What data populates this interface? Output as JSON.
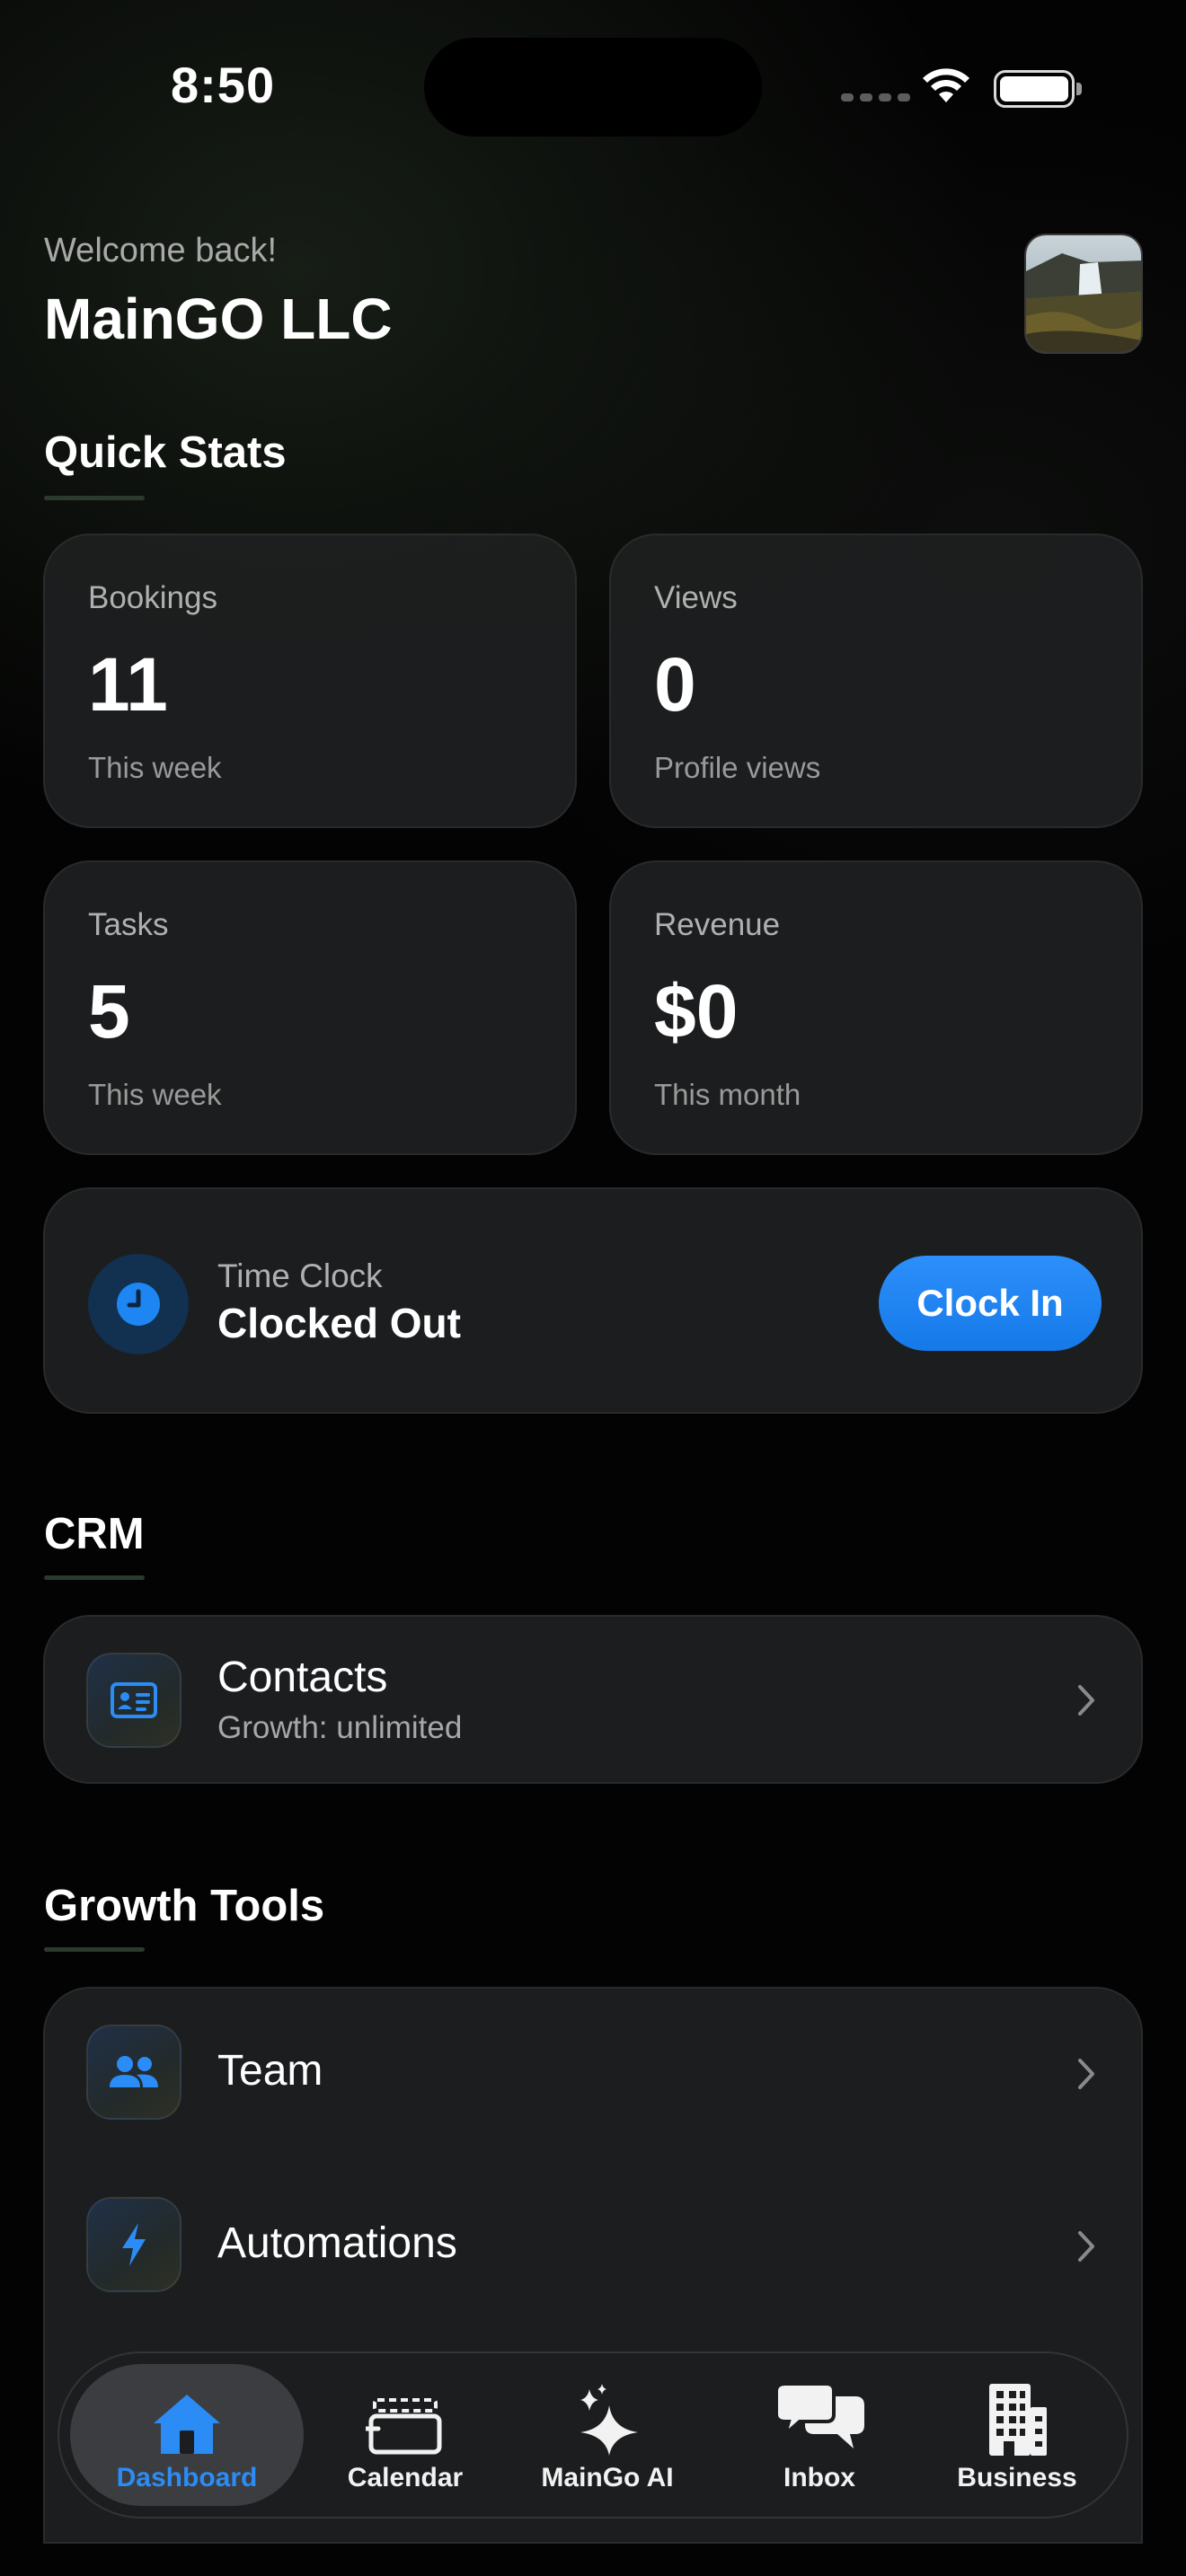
{
  "status_bar": {
    "time": "8:50"
  },
  "header": {
    "welcome": "Welcome back!",
    "company": "MainGO LLC"
  },
  "sections": {
    "quick_stats": "Quick Stats",
    "crm": "CRM",
    "growth_tools": "Growth Tools"
  },
  "stats": [
    {
      "label": "Bookings",
      "value": "11",
      "sub": "This week"
    },
    {
      "label": "Views",
      "value": "0",
      "sub": "Profile views"
    },
    {
      "label": "Tasks",
      "value": "5",
      "sub": "This week"
    },
    {
      "label": "Revenue",
      "value": "$0",
      "sub": "This month"
    }
  ],
  "time_clock": {
    "label": "Time Clock",
    "status": "Clocked Out",
    "button": "Clock In"
  },
  "crm": {
    "contacts": {
      "title": "Contacts",
      "sub": "Growth: unlimited"
    }
  },
  "growth_tools": [
    {
      "title": "Team",
      "icon": "people-icon"
    },
    {
      "title": "Automations",
      "icon": "bolt-icon"
    }
  ],
  "tabs": [
    {
      "label": "Dashboard",
      "icon": "house-icon",
      "active": true
    },
    {
      "label": "Calendar",
      "icon": "calendar-icon"
    },
    {
      "label": "MainGo AI",
      "icon": "sparkles-icon"
    },
    {
      "label": "Inbox",
      "icon": "chat-bubbles-icon"
    },
    {
      "label": "Business",
      "icon": "building-icon"
    }
  ],
  "colors": {
    "accent": "#2b8cf6",
    "background": "#030303",
    "card": "#1e1f21"
  }
}
